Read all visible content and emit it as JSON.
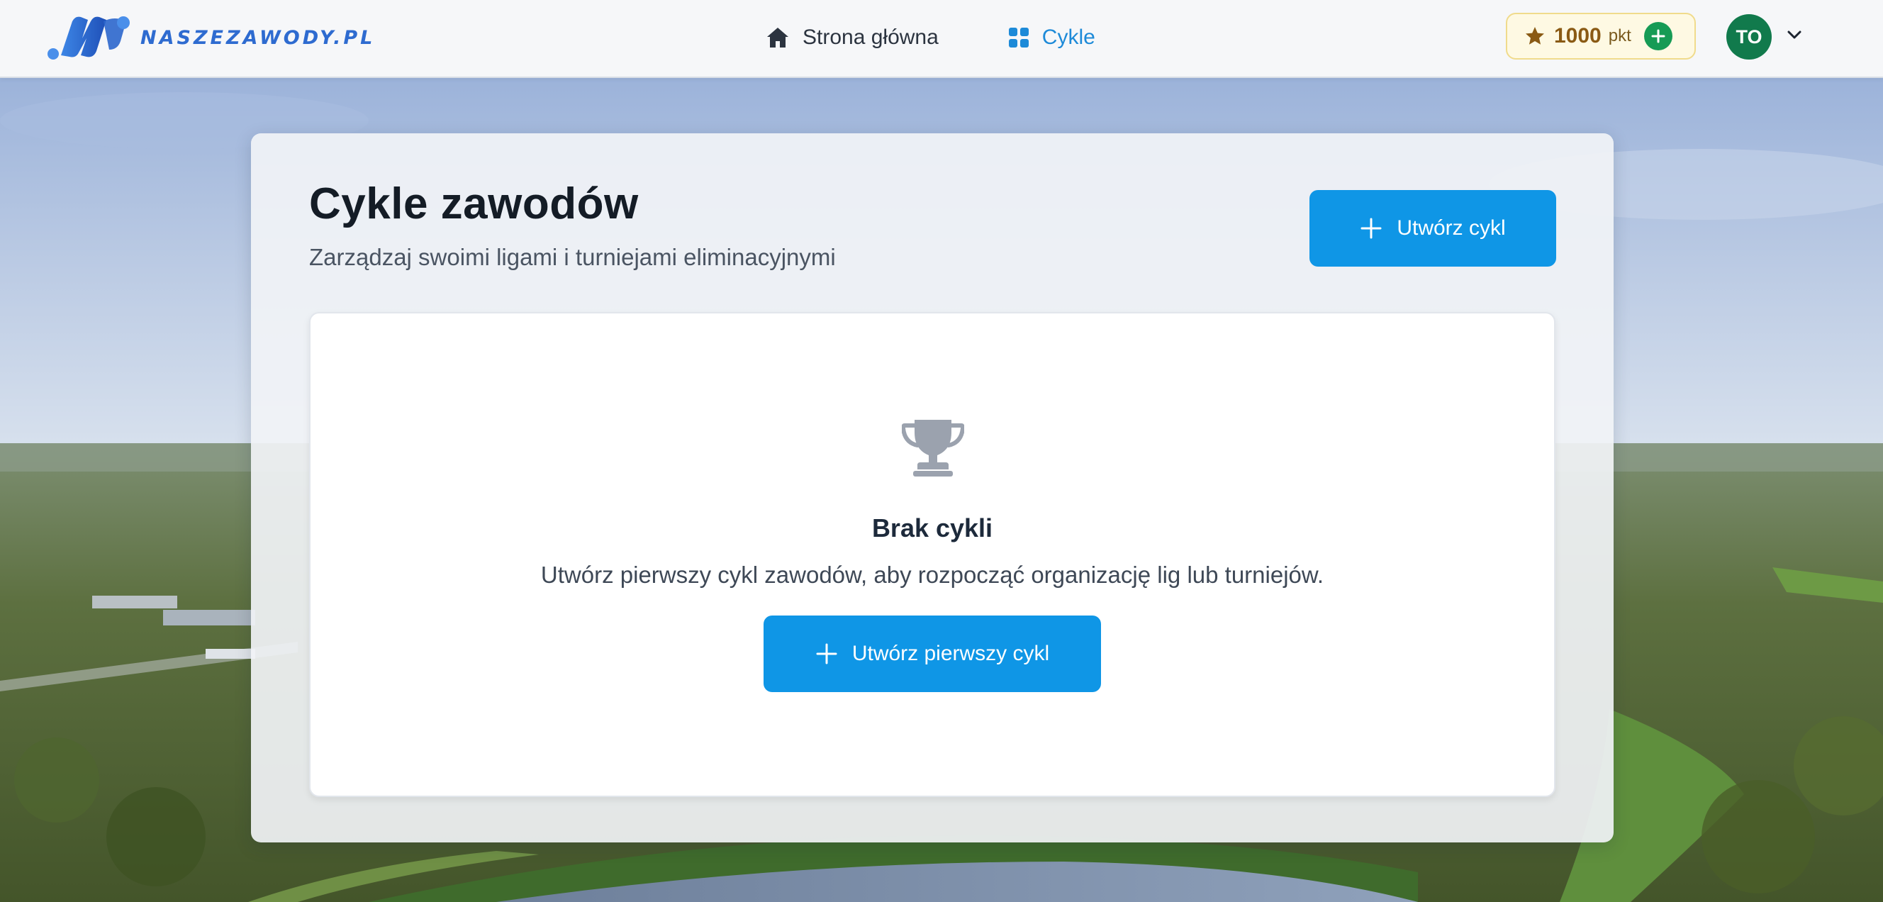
{
  "brand": {
    "name": "NASZEZAWODY.PL",
    "accent": "#2e6bd0"
  },
  "nav": {
    "items": [
      {
        "label": "Strona główna",
        "icon": "home-icon",
        "active": false
      },
      {
        "label": "Cykle",
        "icon": "grid-icon",
        "active": true
      }
    ],
    "active_color": "#1d8ad8"
  },
  "points": {
    "value": "1000",
    "unit": "pkt",
    "icon": "star-icon",
    "add_icon": "plus-icon"
  },
  "user": {
    "initials": "TO",
    "avatar_color": "#117a4c",
    "menu_icon": "chevron-down-icon"
  },
  "page": {
    "title": "Cykle zawodów",
    "subtitle": "Zarządzaj swoimi ligami i turniejami eliminacyjnymi",
    "create_button_label": "Utwórz cykl"
  },
  "empty_state": {
    "icon": "trophy-icon",
    "title": "Brak cykli",
    "text": "Utwórz pierwszy cykl zawodów, aby rozpocząć organizację lig lub turniejów.",
    "button_label": "Utwórz pierwszy cykl"
  },
  "colors": {
    "primary_button": "#0f96e6",
    "points_badge_bg": "#fef9e3",
    "points_add": "#169b55"
  }
}
